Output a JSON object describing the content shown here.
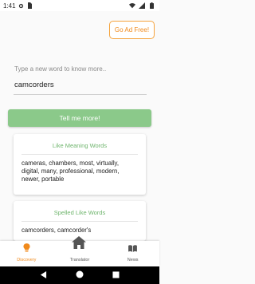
{
  "status_bar": {
    "time": "1:41"
  },
  "header": {
    "ad_button_label": "Go Ad Free!"
  },
  "search": {
    "prompt": "Type a new word to know more..",
    "value": "camcorders",
    "submit_label": "Tell me more!"
  },
  "cards": {
    "meaning": {
      "title": "Like Meaning Words",
      "body": "cameras, chambers, most, virtually, digital, many, professional, modern, newer, portable"
    },
    "spelled": {
      "title": "Spelled Like Words",
      "body": "camcorders, camcorder's"
    }
  },
  "bottom_nav": {
    "items": [
      {
        "label": "Discovery",
        "icon": "lightbulb-icon"
      },
      {
        "label": "Translator",
        "icon": "home-icon"
      },
      {
        "label": "News",
        "icon": "book-icon"
      }
    ],
    "active_index": 0
  },
  "colors": {
    "accent": "#f08a1c",
    "primary_green": "#8bc98a",
    "title_green": "#6fb56d"
  }
}
